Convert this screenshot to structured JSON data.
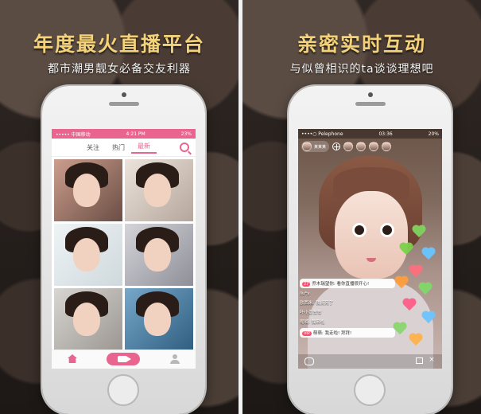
{
  "left_panel": {
    "headline": "年度最火直播平台",
    "subline": "都市潮男靓女必备交友利器",
    "screen": {
      "status_left": "••••• 中国移动",
      "status_time": "4:21 PM",
      "status_right": "23%",
      "tabs": [
        "关注",
        "热门",
        "最新"
      ]
    }
  },
  "right_panel": {
    "headline": "亲密实时互动",
    "subline": "与似曾相识的ta谈谈理想吧",
    "screen": {
      "status_left": "••••○ Pelephone",
      "status_time": "03:36",
      "status_right": "20%",
      "host_name": "某某某",
      "chat_messages": [
        {
          "badge": "27",
          "text": "乔木瑞望你: 看你直播很开心!"
        },
        {
          "badge": "",
          "text": "liu*y"
        },
        {
          "badge": "",
          "text": "欧西米: 我点亮了"
        },
        {
          "badge": "",
          "text": "叶小景赞赞"
        },
        {
          "badge": "",
          "text": "呢喃: 我来啦"
        },
        {
          "badge": "VIP",
          "text": "萌萌: 我走啦! 拜拜!"
        }
      ]
    }
  },
  "colors": {
    "accent_pink": "#e9658f",
    "headline_gold": "#f4d27a"
  }
}
